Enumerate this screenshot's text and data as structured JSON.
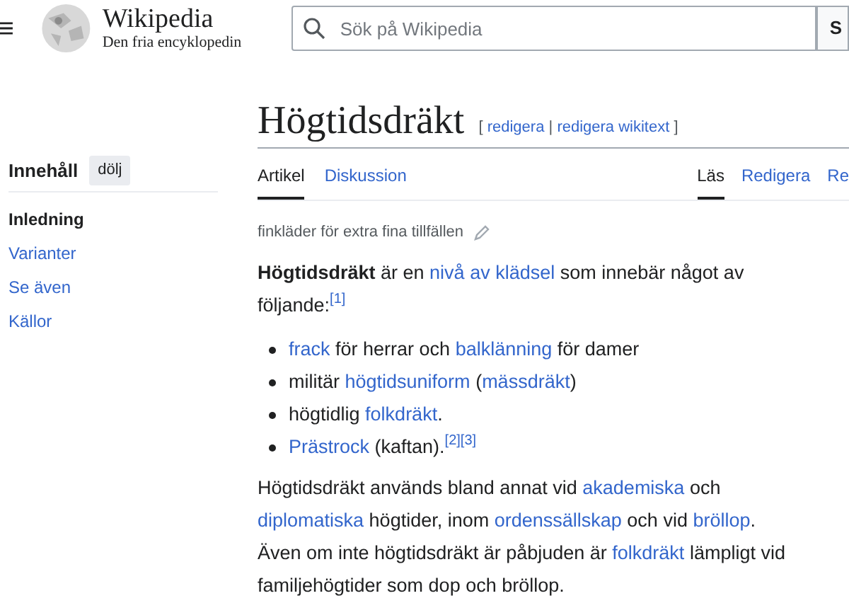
{
  "header": {
    "wordmark": "Wikipedia",
    "tagline": "Den fria encyklopedin",
    "search": {
      "placeholder": "Sök på Wikipedia"
    },
    "search_button": "S"
  },
  "toc": {
    "title": "Innehåll",
    "toggle": "dölj",
    "items": [
      {
        "label": "Inledning",
        "selected": true
      },
      {
        "label": "Varianter",
        "selected": false
      },
      {
        "label": "Se även",
        "selected": false
      },
      {
        "label": "Källor",
        "selected": false
      }
    ]
  },
  "article": {
    "title": "Högtidsdräkt",
    "edit_links": {
      "open": "[",
      "items": [
        "redigera",
        "redigera wikitext"
      ],
      "sep": "|",
      "close": "]"
    },
    "tabs_left": [
      {
        "label": "Artikel",
        "selected": true
      },
      {
        "label": "Diskussion",
        "selected": false
      }
    ],
    "tabs_right": [
      {
        "label": "Läs",
        "selected": true
      },
      {
        "label": "Redigera",
        "selected": false
      },
      {
        "label": "Re",
        "selected": false
      }
    ],
    "short_description": "finkläder för extra fina tillfällen",
    "content": [
      {
        "kind": "paragraph",
        "segments": [
          {
            "kind": "bold",
            "text": "Högtidsdräkt"
          },
          {
            "kind": "text",
            "text": " är en "
          },
          {
            "kind": "link",
            "text": "nivå av klädsel"
          },
          {
            "kind": "text",
            "text": " som innebär något av följande:"
          },
          {
            "kind": "ref",
            "text": "[1]"
          }
        ]
      },
      {
        "kind": "list",
        "items": [
          [
            {
              "kind": "link",
              "text": "frack"
            },
            {
              "kind": "text",
              "text": " för herrar och "
            },
            {
              "kind": "link",
              "text": "balklänning"
            },
            {
              "kind": "text",
              "text": " för damer"
            }
          ],
          [
            {
              "kind": "text",
              "text": "militär "
            },
            {
              "kind": "link",
              "text": "högtidsuniform"
            },
            {
              "kind": "text",
              "text": " ("
            },
            {
              "kind": "link",
              "text": "mässdräkt"
            },
            {
              "kind": "text",
              "text": ")"
            }
          ],
          [
            {
              "kind": "text",
              "text": "högtidlig "
            },
            {
              "kind": "link",
              "text": "folkdräkt"
            },
            {
              "kind": "text",
              "text": "."
            }
          ],
          [
            {
              "kind": "link",
              "text": "Prästrock"
            },
            {
              "kind": "text",
              "text": " (kaftan)."
            },
            {
              "kind": "ref",
              "text": "[2]"
            },
            {
              "kind": "ref",
              "text": "[3]"
            }
          ]
        ]
      },
      {
        "kind": "paragraph",
        "segments": [
          {
            "kind": "text",
            "text": "Högtidsdräkt används bland annat vid "
          },
          {
            "kind": "link",
            "text": "akademiska"
          },
          {
            "kind": "text",
            "text": " och "
          },
          {
            "kind": "link",
            "text": "diplomatiska"
          },
          {
            "kind": "text",
            "text": " högtider, inom "
          },
          {
            "kind": "link",
            "text": "ordenssällskap"
          },
          {
            "kind": "text",
            "text": " och vid "
          },
          {
            "kind": "link",
            "text": "bröllop"
          },
          {
            "kind": "text",
            "text": ". Även om inte högtidsdräkt är påbjuden är "
          },
          {
            "kind": "link",
            "text": "folkdräkt"
          },
          {
            "kind": "text",
            "text": " lämpligt vid familjehögtider som dop och bröllop."
          }
        ]
      }
    ]
  }
}
